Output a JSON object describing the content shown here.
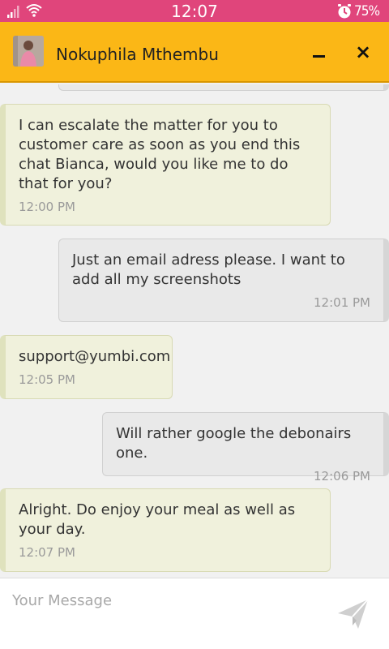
{
  "status_bar": {
    "time": "12:07",
    "battery": "75%"
  },
  "header": {
    "agent_name": "Nokuphila Mthembu",
    "close_label": "×"
  },
  "messages": [
    {
      "from": "agent",
      "text": "I can escalate the matter for you to customer care as soon as you end this chat Bianca, would you like me to do that for you?",
      "time": "12:00 PM"
    },
    {
      "from": "user",
      "text": "Just an email adress please. I want to add all my screenshots",
      "time": "12:01 PM"
    },
    {
      "from": "agent",
      "text": "support@yumbi.com",
      "time": "12:05 PM"
    },
    {
      "from": "user",
      "text": "Will rather google the debonairs one.",
      "time": "12:06 PM"
    },
    {
      "from": "agent",
      "text": "Alright. Do enjoy your meal as well as your day.",
      "time": "12:07 PM"
    }
  ],
  "composer": {
    "placeholder": "Your Message"
  },
  "colors": {
    "status_bar": "#e0457b",
    "header": "#fbb716",
    "agent_bubble": "#f0f1dc",
    "user_bubble": "#e9e9e9"
  },
  "icons": {
    "signal": "signal-icon",
    "wifi": "wifi-icon",
    "alarm": "alarm-icon",
    "minimize": "minimize-icon",
    "close": "close-icon",
    "send": "send-icon"
  }
}
